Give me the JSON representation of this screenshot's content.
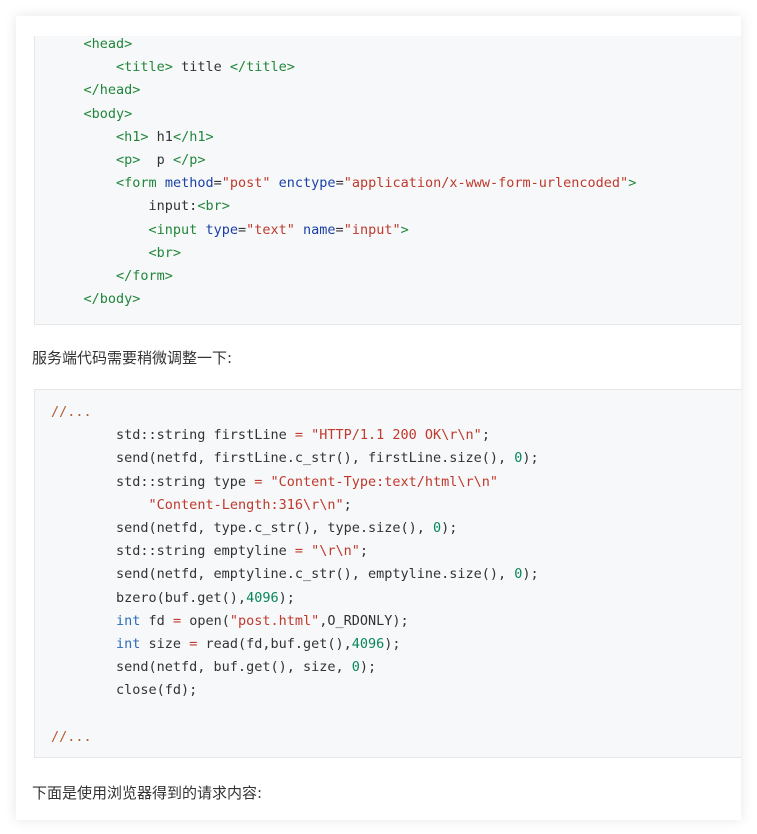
{
  "html_code_lines": [
    [
      {
        "t": "    ",
        "c": ""
      },
      {
        "t": "<head>",
        "c": "tag"
      }
    ],
    [
      {
        "t": "        ",
        "c": ""
      },
      {
        "t": "<title>",
        "c": "tag"
      },
      {
        "t": " title ",
        "c": ""
      },
      {
        "t": "</title>",
        "c": "tag"
      }
    ],
    [
      {
        "t": "    ",
        "c": ""
      },
      {
        "t": "</head>",
        "c": "tag"
      }
    ],
    [
      {
        "t": "    ",
        "c": ""
      },
      {
        "t": "<body>",
        "c": "tag"
      }
    ],
    [
      {
        "t": "        ",
        "c": ""
      },
      {
        "t": "<h1>",
        "c": "tag"
      },
      {
        "t": " h1",
        "c": ""
      },
      {
        "t": "</h1>",
        "c": "tag"
      }
    ],
    [
      {
        "t": "        ",
        "c": ""
      },
      {
        "t": "<p>",
        "c": "tag"
      },
      {
        "t": "  p ",
        "c": ""
      },
      {
        "t": "</p>",
        "c": "tag"
      }
    ],
    [
      {
        "t": "        ",
        "c": ""
      },
      {
        "t": "<form ",
        "c": "tag"
      },
      {
        "t": "method",
        "c": "attr"
      },
      {
        "t": "=",
        "c": ""
      },
      {
        "t": "\"post\"",
        "c": "str"
      },
      {
        "t": " ",
        "c": ""
      },
      {
        "t": "enctype",
        "c": "attr"
      },
      {
        "t": "=",
        "c": ""
      },
      {
        "t": "\"application/x-www-form-urlencoded\"",
        "c": "str"
      },
      {
        "t": ">",
        "c": "tag"
      }
    ],
    [
      {
        "t": "            ",
        "c": ""
      },
      {
        "t": "input:",
        "c": ""
      },
      {
        "t": "<br>",
        "c": "tag"
      }
    ],
    [
      {
        "t": "            ",
        "c": ""
      },
      {
        "t": "<input ",
        "c": "tag"
      },
      {
        "t": "type",
        "c": "attr"
      },
      {
        "t": "=",
        "c": ""
      },
      {
        "t": "\"text\"",
        "c": "str"
      },
      {
        "t": " ",
        "c": ""
      },
      {
        "t": "name",
        "c": "attr"
      },
      {
        "t": "=",
        "c": ""
      },
      {
        "t": "\"input\"",
        "c": "str"
      },
      {
        "t": ">",
        "c": "tag"
      }
    ],
    [
      {
        "t": "            ",
        "c": ""
      },
      {
        "t": "<br>",
        "c": "tag"
      }
    ],
    [
      {
        "t": "        ",
        "c": ""
      },
      {
        "t": "</form>",
        "c": "tag"
      }
    ],
    [
      {
        "t": "    ",
        "c": ""
      },
      {
        "t": "</body>",
        "c": "tag"
      }
    ]
  ],
  "paragraph_server": "服务端代码需要稍微调整一下:",
  "cpp_code_lines": [
    [
      {
        "t": "//...",
        "c": "com"
      }
    ],
    [
      {
        "t": "        std::string firstLine ",
        "c": ""
      },
      {
        "t": "=",
        "c": "op"
      },
      {
        "t": " ",
        "c": ""
      },
      {
        "t": "\"HTTP/1.1 200 OK\\r\\n\"",
        "c": "str"
      },
      {
        "t": ";",
        "c": ""
      }
    ],
    [
      {
        "t": "        send(netfd, firstLine.c_str(), firstLine.size(), ",
        "c": ""
      },
      {
        "t": "0",
        "c": "num"
      },
      {
        "t": ");",
        "c": ""
      }
    ],
    [
      {
        "t": "        std::string type ",
        "c": ""
      },
      {
        "t": "=",
        "c": "op"
      },
      {
        "t": " ",
        "c": ""
      },
      {
        "t": "\"Content-Type:text/html\\r\\n\"",
        "c": "str"
      }
    ],
    [
      {
        "t": "            ",
        "c": ""
      },
      {
        "t": "\"Content-Length:316\\r\\n\"",
        "c": "str"
      },
      {
        "t": ";",
        "c": ""
      }
    ],
    [
      {
        "t": "        send(netfd, type.c_str(), type.size(), ",
        "c": ""
      },
      {
        "t": "0",
        "c": "num"
      },
      {
        "t": ");",
        "c": ""
      }
    ],
    [
      {
        "t": "        std::string emptyline ",
        "c": ""
      },
      {
        "t": "=",
        "c": "op"
      },
      {
        "t": " ",
        "c": ""
      },
      {
        "t": "\"\\r\\n\"",
        "c": "str"
      },
      {
        "t": ";",
        "c": ""
      }
    ],
    [
      {
        "t": "        send(netfd, emptyline.c_str(), emptyline.size(), ",
        "c": ""
      },
      {
        "t": "0",
        "c": "num"
      },
      {
        "t": ");",
        "c": ""
      }
    ],
    [
      {
        "t": "        bzero(buf.get(),",
        "c": ""
      },
      {
        "t": "4096",
        "c": "num"
      },
      {
        "t": ");",
        "c": ""
      }
    ],
    [
      {
        "t": "        ",
        "c": ""
      },
      {
        "t": "int",
        "c": "kw"
      },
      {
        "t": " fd ",
        "c": ""
      },
      {
        "t": "=",
        "c": "op"
      },
      {
        "t": " open(",
        "c": ""
      },
      {
        "t": "\"post.html\"",
        "c": "str"
      },
      {
        "t": ",O_RDONLY);",
        "c": ""
      }
    ],
    [
      {
        "t": "        ",
        "c": ""
      },
      {
        "t": "int",
        "c": "kw"
      },
      {
        "t": " size ",
        "c": ""
      },
      {
        "t": "=",
        "c": "op"
      },
      {
        "t": " read(fd,buf.get(),",
        "c": ""
      },
      {
        "t": "4096",
        "c": "num"
      },
      {
        "t": ");",
        "c": ""
      }
    ],
    [
      {
        "t": "        send(netfd, buf.get(), size, ",
        "c": ""
      },
      {
        "t": "0",
        "c": "num"
      },
      {
        "t": ");",
        "c": ""
      }
    ],
    [
      {
        "t": "        close(fd);",
        "c": ""
      }
    ],
    [
      {
        "t": "",
        "c": ""
      }
    ],
    [
      {
        "t": "//...",
        "c": "com"
      }
    ]
  ],
  "paragraph_browser": "下面是使用浏览器得到的请求内容:"
}
